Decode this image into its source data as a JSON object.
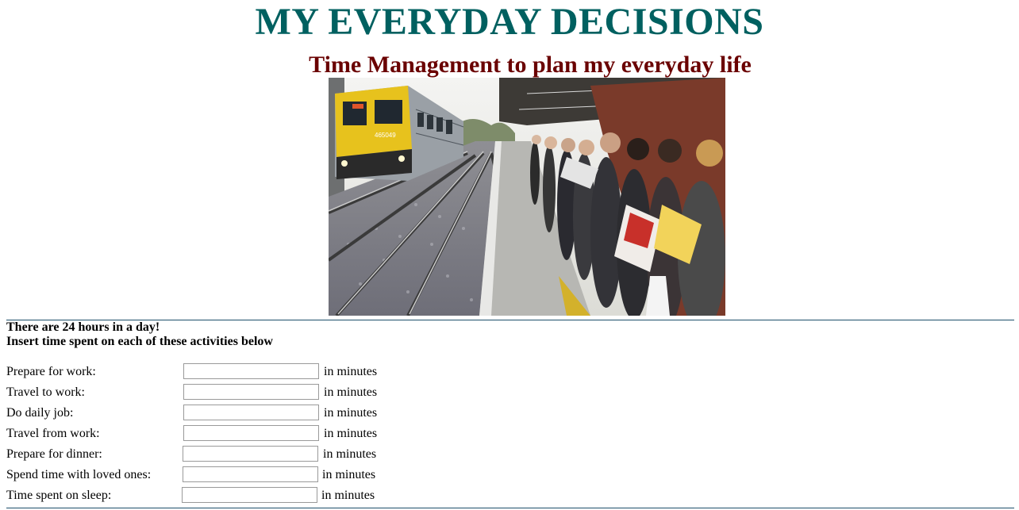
{
  "header": {
    "title": "MY EVERYDAY DECISIONS",
    "subtitle": "Time Management to plan my everyday life"
  },
  "photo": {
    "train_number": "465049",
    "description_icon": "railway-platform-photo"
  },
  "intro": {
    "line1": "There are 24 hours in a day!",
    "line2": "Insert time spent on each of these activities below"
  },
  "activities": [
    {
      "label": "Prepare for work:",
      "value": "",
      "unit": "in minutes"
    },
    {
      "label": "Travel to work:",
      "value": "",
      "unit": "in minutes"
    },
    {
      "label": "Do daily job:",
      "value": "",
      "unit": "in minutes"
    },
    {
      "label": "Travel from work:",
      "value": "",
      "unit": "in minutes"
    },
    {
      "label": "Prepare for dinner:",
      "value": "",
      "unit": "in minutes"
    },
    {
      "label": "Spend time with loved ones:",
      "value": "",
      "unit": "in minutes"
    },
    {
      "label": "Time spent on sleep:",
      "value": "",
      "unit": "in minutes"
    }
  ],
  "colors": {
    "title": "#006060",
    "subtitle": "#6a0000",
    "rule": "#1c4f6a"
  }
}
